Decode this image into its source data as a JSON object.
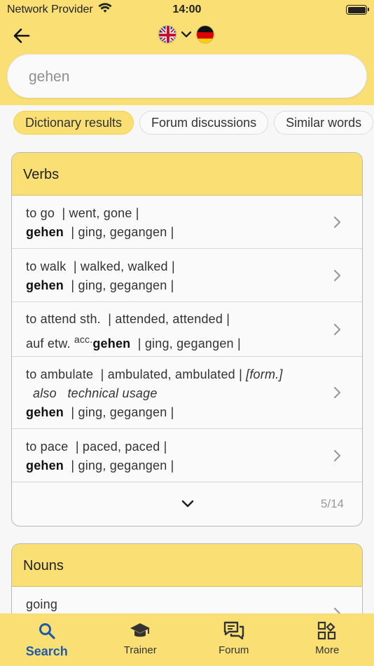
{
  "status": {
    "carrier": "Network Provider",
    "time": "14:00"
  },
  "header": {
    "from_flag": "uk-flag",
    "to_flag": "germany-flag"
  },
  "search": {
    "query": "gehen"
  },
  "chips": [
    "Dictionary results",
    "Forum discussions",
    "Similar words"
  ],
  "verbs": {
    "title": "Verbs",
    "entries": [
      {
        "en": "to go",
        "en_forms": "| went, gone |",
        "de": "gehen",
        "de_forms": "| ging, gegangen |"
      },
      {
        "en": "to walk",
        "en_forms": "| walked, walked |",
        "de": "gehen",
        "de_forms": "| ging, gegangen |"
      },
      {
        "en": "to attend sth.",
        "en_forms": "| attended, attended |",
        "de_prefix": "auf etw.",
        "de_case": "acc.",
        "de": "gehen",
        "de_forms": "| ging, gegangen |"
      },
      {
        "en": "to ambulate",
        "en_forms": "| ambulated, ambulated |",
        "en_register": "[form.]",
        "note_also": "also",
        "note_usage": "technical usage",
        "de": "gehen",
        "de_forms": "| ging, gegangen |"
      },
      {
        "en": "to pace",
        "en_forms": "| paced, paced |",
        "de": "gehen",
        "de_forms": "| ging, gegangen |"
      }
    ],
    "count": "5/14"
  },
  "nouns": {
    "title": "Nouns",
    "first_entry": "going"
  },
  "tabs": [
    {
      "label": "Search",
      "icon": "search-icon"
    },
    {
      "label": "Trainer",
      "icon": "graduation-cap-icon"
    },
    {
      "label": "Forum",
      "icon": "chat-icon"
    },
    {
      "label": "More",
      "icon": "apps-icon"
    }
  ],
  "colors": {
    "accent": "#f9df74",
    "active_tab": "#1f5aa8"
  }
}
